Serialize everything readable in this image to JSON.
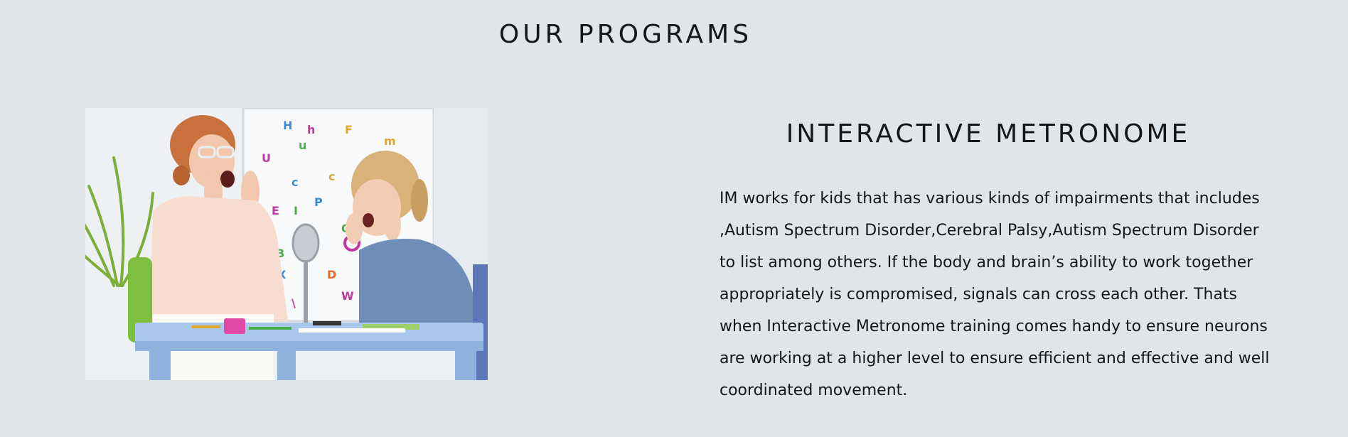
{
  "section": {
    "title": "OUR PROGRAMS"
  },
  "program": {
    "title": "INTERACTIVE METRONOME",
    "description": "IM works for kids that has various kinds of impairments that includes ,Autism Spectrum Disorder,Cerebral Palsy,Autism Spectrum Disorder to list among others. If the body and brain’s ability to work together appropriately is compromised, signals can cross each other. Thats when Interactive Metronome training comes handy to ensure neurons are working at a higher level to ensure efficient and effective and well coordinated movement."
  },
  "colors": {
    "page_background": "#dfe5e8",
    "text": "#161616"
  }
}
